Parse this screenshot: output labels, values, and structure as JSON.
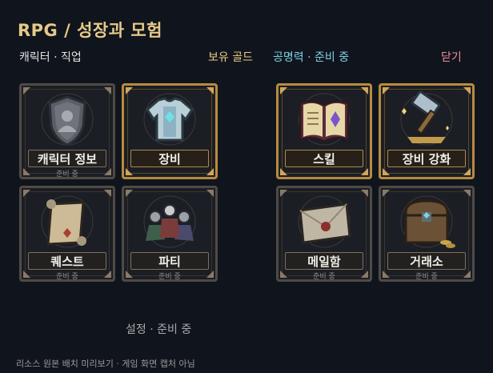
{
  "header": {
    "title": "RPG  /  성장과 모험",
    "tab_label": "캐릭터 · 직업",
    "gold_label": "보유 골드",
    "fame_label": "공명력 · 준비 중",
    "close_label": "닫기"
  },
  "cards": [
    {
      "label": "캐릭터 정보",
      "sub": "준비 중",
      "icon": "character-shield-icon",
      "highlight": false
    },
    {
      "label": "장비",
      "sub": "",
      "icon": "armor-icon",
      "highlight": true
    },
    {
      "label": "스킬",
      "sub": "",
      "icon": "spellbook-icon",
      "highlight": true
    },
    {
      "label": "장비 강화",
      "sub": "",
      "icon": "forge-hammer-icon",
      "highlight": true
    },
    {
      "label": "퀘스트",
      "sub": "준비 중",
      "icon": "quest-scroll-icon",
      "highlight": false
    },
    {
      "label": "파티",
      "sub": "준비 중",
      "icon": "party-icon",
      "highlight": false
    },
    {
      "label": "메일함",
      "sub": "준비 중",
      "icon": "mail-envelope-icon",
      "highlight": false
    },
    {
      "label": "거래소",
      "sub": "준비 중",
      "icon": "treasure-chest-icon",
      "highlight": false
    }
  ],
  "settings_label": "설정 · 준비 중",
  "footer_note": "리소스 원본 배치 미리보기 · 게임 화면 캡처 아님",
  "colors": {
    "background": "#10151d",
    "title": "#e6c98a",
    "gold": "#eacb84",
    "fame": "#7fcfe2",
    "close": "#f08d9b",
    "highlight_border": "#b88a3f"
  }
}
